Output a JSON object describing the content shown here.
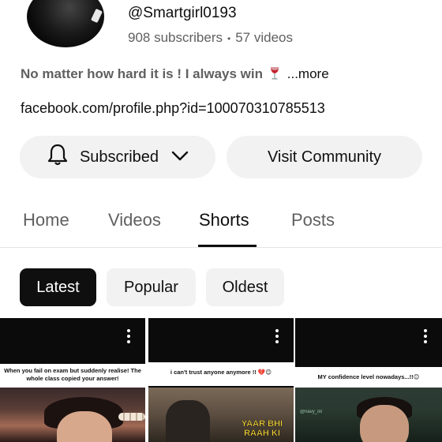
{
  "channel": {
    "handle": "@Smartgirl0193",
    "subscribers": "908 subscribers",
    "separator": "•",
    "videos": "57 videos",
    "description": "No matter how hard it is ! I always win",
    "description_emoji": "wine-glass-icon",
    "more_label": "...more",
    "link": "facebook.com/profile.php?id=100070310785513"
  },
  "actions": {
    "subscribed_label": "Subscribed",
    "visit_label": "Visit Community"
  },
  "tabs": [
    {
      "label": "Home",
      "active": false
    },
    {
      "label": "Videos",
      "active": false
    },
    {
      "label": "Shorts",
      "active": true
    },
    {
      "label": "Posts",
      "active": false
    }
  ],
  "filters": [
    {
      "label": "Latest",
      "active": true
    },
    {
      "label": "Popular",
      "active": false
    },
    {
      "label": "Oldest",
      "active": false
    }
  ],
  "shorts": [
    {
      "caption": "When you fail on exam but suddenly realise! The whole class copied your answer!"
    },
    {
      "caption": "i can't trust anyone anymore !! 💔😊",
      "overlay": "YAAR BHI RAAH KI"
    },
    {
      "caption": "MY confidence level nowadays...!!😊",
      "tag": "@navy_ist"
    }
  ],
  "colors": {
    "text_primary": "#0f0f0f",
    "text_secondary": "#606060",
    "chip_bg": "#f2f2f2",
    "chip_active_bg": "#0f0f0f"
  }
}
